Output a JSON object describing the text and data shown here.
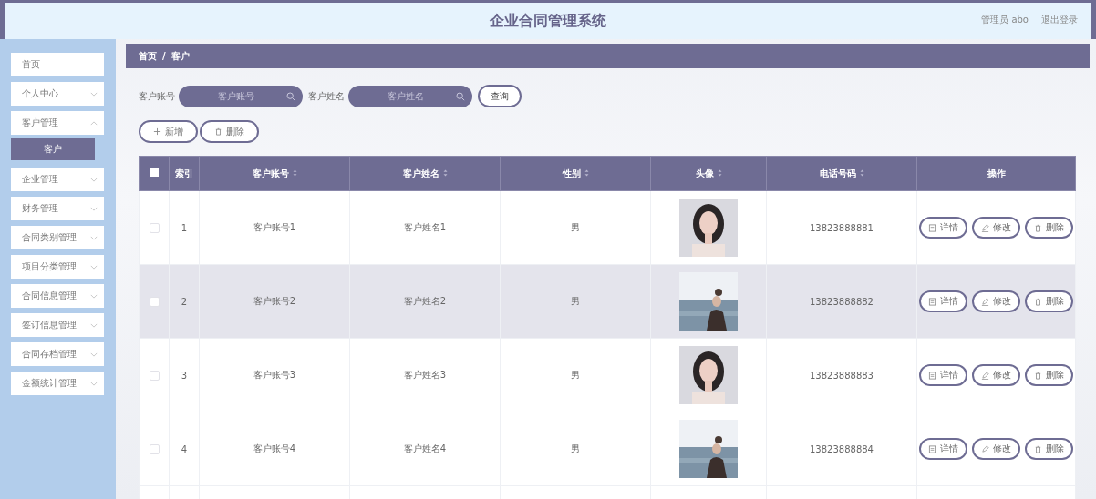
{
  "header": {
    "title": "企业合同管理系统",
    "user": "管理员 abo",
    "logout": "退出登录"
  },
  "sidebar": {
    "items": [
      {
        "label": "首页",
        "expandable": false
      },
      {
        "label": "个人中心",
        "expandable": true,
        "expanded": false
      },
      {
        "label": "客户管理",
        "expandable": true,
        "expanded": true,
        "children": [
          {
            "label": "客户",
            "selected": true
          }
        ]
      },
      {
        "label": "企业管理",
        "expandable": true,
        "expanded": false
      },
      {
        "label": "财务管理",
        "expandable": true,
        "expanded": false
      },
      {
        "label": "合同类别管理",
        "expandable": true,
        "expanded": false
      },
      {
        "label": "项目分类管理",
        "expandable": true,
        "expanded": false
      },
      {
        "label": "合同信息管理",
        "expandable": true,
        "expanded": false
      },
      {
        "label": "签订信息管理",
        "expandable": true,
        "expanded": false
      },
      {
        "label": "合同存档管理",
        "expandable": true,
        "expanded": false
      },
      {
        "label": "金额统计管理",
        "expandable": true,
        "expanded": false
      }
    ]
  },
  "breadcrumb": {
    "items": [
      "首页",
      "客户"
    ],
    "separator": "/"
  },
  "search": {
    "fields": [
      {
        "label": "客户账号",
        "placeholder": "客户账号"
      },
      {
        "label": "客户姓名",
        "placeholder": "客户姓名"
      }
    ],
    "button": "查询"
  },
  "actions": [
    {
      "kind": "add",
      "label": "新增"
    },
    {
      "kind": "delete",
      "label": "删除"
    }
  ],
  "table": {
    "select_all_checked": false,
    "columns": [
      {
        "label": "索引",
        "sortable": false
      },
      {
        "label": "客户账号",
        "sortable": true
      },
      {
        "label": "客户姓名",
        "sortable": true
      },
      {
        "label": "性别",
        "sortable": true
      },
      {
        "label": "头像",
        "sortable": true
      },
      {
        "label": "电话号码",
        "sortable": true
      },
      {
        "label": "操作",
        "sortable": false
      }
    ],
    "rows": [
      {
        "checked": false,
        "highlighted": false,
        "index": "1",
        "account": "客户账号1",
        "name": "客户姓名1",
        "gender": "男",
        "avatar": {
          "kind": "picture"
        },
        "phone": "13823888881",
        "actions": [
          {
            "kind": "detail",
            "label": "详情"
          },
          {
            "kind": "edit",
            "label": "修改"
          },
          {
            "kind": "delete",
            "label": "删除"
          }
        ]
      },
      {
        "checked": false,
        "highlighted": true,
        "index": "2",
        "account": "客户账号2",
        "name": "客户姓名2",
        "gender": "男",
        "avatar": {
          "kind": "picture"
        },
        "phone": "13823888882",
        "actions": [
          {
            "kind": "detail",
            "label": "详情"
          },
          {
            "kind": "edit",
            "label": "修改"
          },
          {
            "kind": "delete",
            "label": "删除"
          }
        ]
      },
      {
        "checked": false,
        "highlighted": false,
        "index": "3",
        "account": "客户账号3",
        "name": "客户姓名3",
        "gender": "男",
        "avatar": {
          "kind": "picture"
        },
        "phone": "13823888883",
        "actions": [
          {
            "kind": "detail",
            "label": "详情"
          },
          {
            "kind": "edit",
            "label": "修改"
          },
          {
            "kind": "delete",
            "label": "删除"
          }
        ]
      },
      {
        "checked": false,
        "highlighted": false,
        "index": "4",
        "account": "客户账号4",
        "name": "客户姓名4",
        "gender": "男",
        "avatar": {
          "kind": "picture"
        },
        "phone": "13823888884",
        "actions": [
          {
            "kind": "detail",
            "label": "详情"
          },
          {
            "kind": "edit",
            "label": "修改"
          },
          {
            "kind": "delete",
            "label": "删除"
          }
        ]
      }
    ]
  }
}
